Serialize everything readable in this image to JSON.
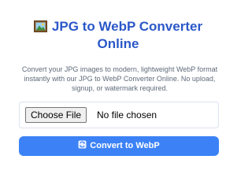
{
  "header": {
    "title_line1": "JPG to WebP Converter",
    "title_line2": "Online",
    "title_icon": "picture-icon"
  },
  "description": {
    "text": "Convert your JPG images to modern, lightweight WebP format instantly with our JPG to WebP Converter Online. No upload, signup, or watermark required."
  },
  "file_input": {
    "button_label": "Choose File",
    "status_text": "No file chosen"
  },
  "convert": {
    "label": "Convert to WebP",
    "icon": "convert-arrows-icon"
  },
  "colors": {
    "title": "#2b58c8",
    "description": "#5f6b7a",
    "button": "#3c82f6",
    "border": "#dbe3ef"
  }
}
